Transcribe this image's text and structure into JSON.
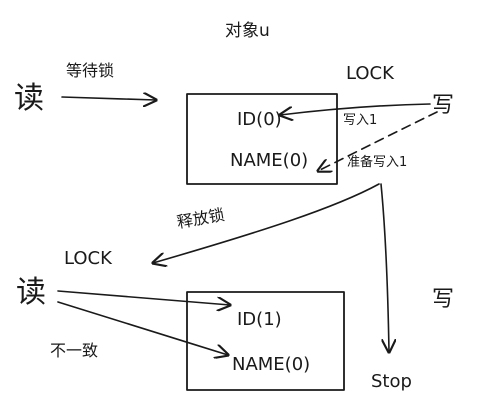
{
  "title": "对象u",
  "top_box": {
    "field_id": "ID(0)",
    "field_name": "NAME(0)"
  },
  "bottom_box": {
    "field_id": "ID(1)",
    "field_name": "NAME(0)"
  },
  "actors": {
    "reader_top": "读",
    "reader_bottom": "读",
    "writer_top": "写",
    "writer_bottom": "写"
  },
  "labels": {
    "wait_lock": "等待锁",
    "lock_top": "LOCK",
    "lock_bottom": "LOCK",
    "write_in": "写入1",
    "prepare_write": "准备写入1",
    "release_lock": "释放锁",
    "inconsistent": "不一致",
    "stop": "Stop"
  }
}
